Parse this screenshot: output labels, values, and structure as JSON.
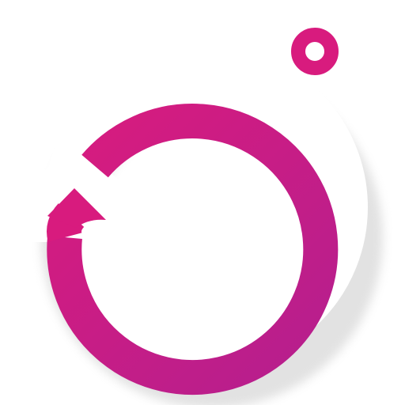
{
  "icon": {
    "name": "refresh-loop-app-icon",
    "primary_color": "#D81B7E",
    "secondary_color": "#B51F8E",
    "outline_color": "#FFFFFF",
    "shadow_color": "#BFBFBF",
    "background_color": "#FFFFFF"
  }
}
